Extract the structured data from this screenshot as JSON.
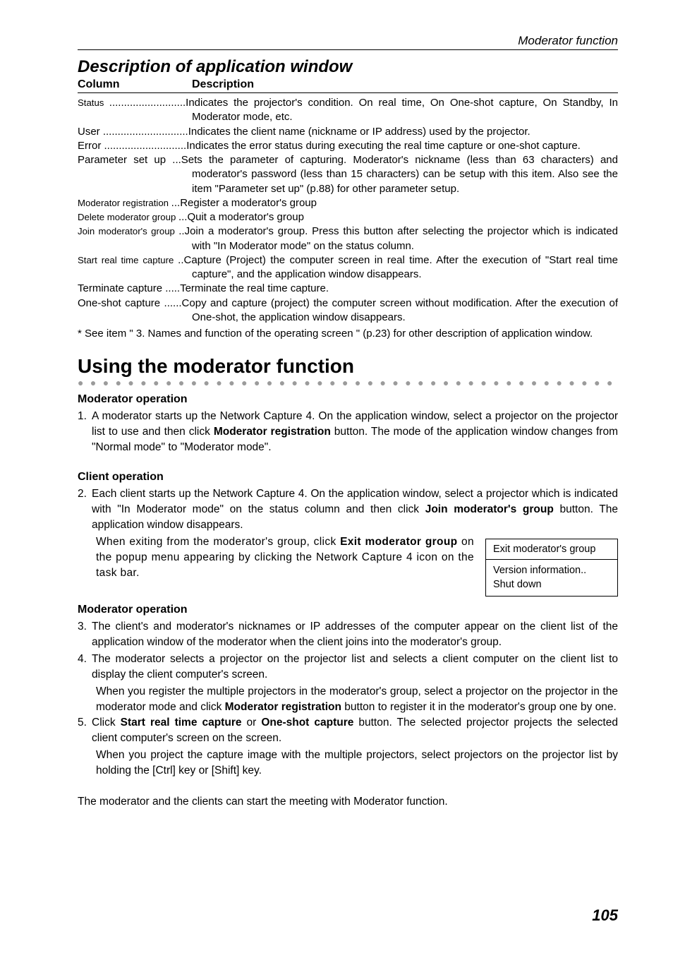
{
  "runningHead": "Moderator function",
  "sectionTitle": "Description of application window",
  "table": {
    "colHead1": "Column",
    "colHead2": "Description",
    "rows": [
      {
        "left": "Status",
        "dots": "..........................",
        "text": "Indicates the projector's condition. On real time, On One-shot capture, On Standby, In Moderator mode, etc.",
        "condensed": true
      },
      {
        "left": "User",
        "dots": ".............................",
        "text": "Indicates the client name (nickname or IP address) used by the projector."
      },
      {
        "left": "Error",
        "dots": "............................",
        "text": "Indicates the error status during executing the real time capture or one-shot capture."
      },
      {
        "left": "Parameter set up",
        "dots": "...",
        "text": "Sets the parameter of capturing. Moderator's nickname (less than 63 characters) and moderator's password (less than 15 characters) can be setup with this item. Also see the item \"Parameter set up\" (p.88) for other parameter setup.",
        "contLines": 2
      },
      {
        "left": "Moderator registration",
        "dots": "...",
        "text": "Register a  moderator's group",
        "condensed": true
      },
      {
        "left": "Delete moderator group",
        "dots": "...",
        "text": "Quit a moderator's group",
        "condensed": true
      },
      {
        "left": "Join moderator's group",
        "dots": "..",
        "text": "Join a  moderator's group. Press this button after selecting the projector which is indicated with \"In Moderator mode\" on the status column.",
        "condensed": true,
        "contLines": 1
      },
      {
        "left": "Start real time capture",
        "dots": "..",
        "text": "Capture (Project) the computer screen in real time.  After the execution of \"Start real time capture\", and the application window disappears.",
        "condensed": true,
        "contLines": 1
      },
      {
        "left": "Terminate capture",
        "dots": ".....",
        "text": "Terminate the real time capture."
      },
      {
        "left": "One-shot capture",
        "dots": "......",
        "text": "Copy and capture (project) the computer screen without modification. After the execution of One-shot, the application window disappears.",
        "contLines": 1
      }
    ],
    "note": "* See item \" 3. Names and function of the operating screen \" (p.23) for other description of application window."
  },
  "h1": "Using the moderator function",
  "dotRule": "●●●●●●●●●●●●●●●●●●●●●●●●●●●●●●●●●●●●●●●●●●●●●●●●",
  "modOp1": {
    "head": "Moderator operation",
    "num": "1.",
    "pre": "A moderator starts up the Network Capture 4. On the application window, select a projector on the projector list to use and then click ",
    "bold": "Moderator registration",
    "post": " button. The mode of the application window changes from \"Normal mode\" to \"Moderator mode\"."
  },
  "cliOp": {
    "head": "Client operation",
    "num": "2.",
    "pre": "Each client starts up the Network Capture 4. On the application window, select a projector which is indicated with \"In Moderator mode\" on the status column and then click ",
    "bold": "Join moderator's group",
    "post": " button. The application window disappears.",
    "indentPre": "When exiting from the moderator's group, click ",
    "indentBold": "Exit moderator group",
    "indentPost": " on the popup menu appearing by clicking the Network Capture 4 icon on the task bar."
  },
  "popup": {
    "line1": "Exit moderator's group",
    "line2": "Version information..",
    "line3": "Shut down"
  },
  "modOp2": {
    "head": "Moderator operation",
    "item3num": "3.",
    "item3": "The client's and moderator's nicknames or IP addresses of the computer appear on the client list of the application window of the moderator when the client joins into the moderator's group.",
    "item4num": "4.",
    "item4": "The moderator selects a projector on the projector list and selects a client computer on the client list to display the client computer's screen.",
    "item4indentPre": "When you register the multiple projectors in the moderator's group, select a projector on the projector in the moderator mode and click ",
    "item4indentBold": "Moderator registration",
    "item4indentPost": " button to register it in the moderator's group one by one.",
    "item5num": "5.",
    "item5pre": "Click ",
    "item5b1": "Start real time capture",
    "item5mid": " or ",
    "item5b2": "One-shot capture",
    "item5post": " button. The selected projector projects the selected client computer's screen on the screen.",
    "item5indent": "When you project the capture image with the multiple projectors, select projectors on the projector list by holding the [Ctrl] key or [Shift] key."
  },
  "closing": "The moderator and the clients can start the meeting with Moderator function.",
  "pageNum": "105"
}
